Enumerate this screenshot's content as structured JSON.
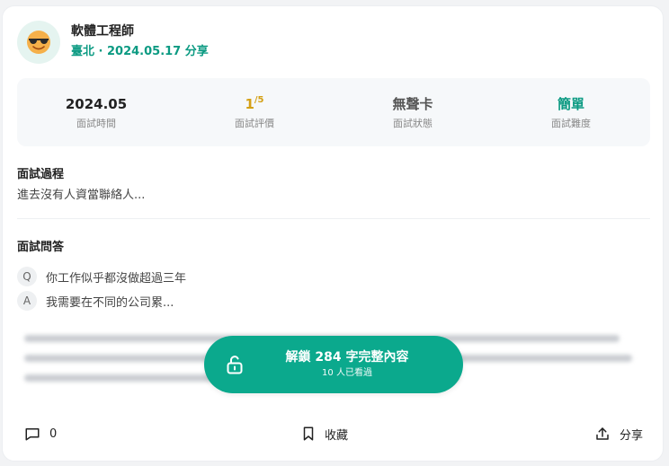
{
  "header": {
    "title": "軟體工程師",
    "subtitle": "臺北 · 2024.05.17 分享",
    "avatar_icon": "smiling-face-with-sunglasses-icon"
  },
  "stats": {
    "date": {
      "value": "2024.05",
      "label": "面試時間"
    },
    "rating": {
      "value": "1",
      "max_text": "/5",
      "label": "面試評價",
      "color": "#d4a015"
    },
    "status": {
      "value": "無聲卡",
      "label": "面試狀態"
    },
    "difficulty": {
      "value": "簡單",
      "label": "面試難度",
      "color": "#0b9a82"
    }
  },
  "process": {
    "title": "面試過程",
    "text": "進去沒有人資當聯絡人..."
  },
  "qa": {
    "title": "面試問答",
    "items": [
      {
        "badge": "Q",
        "text": "你工作似乎都沒做超過三年"
      },
      {
        "badge": "A",
        "text": "我需要在不同的公司累..."
      }
    ]
  },
  "unlock": {
    "label": "解鎖 284 字完整內容",
    "sub_label": "10 人已看過",
    "color": "#0ba98d"
  },
  "footer": {
    "comment_count": "0",
    "save_label": "收藏",
    "share_label": "分享"
  }
}
